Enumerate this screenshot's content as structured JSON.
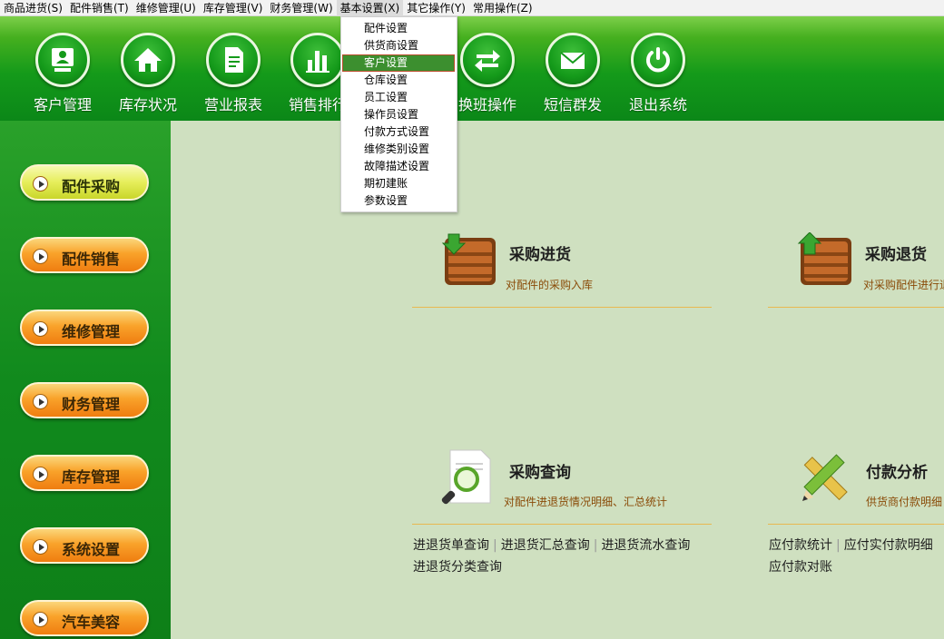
{
  "menubar": {
    "items": [
      {
        "label": "商品进货(S)"
      },
      {
        "label": "配件销售(T)"
      },
      {
        "label": "维修管理(U)"
      },
      {
        "label": "库存管理(V)"
      },
      {
        "label": "财务管理(W)"
      },
      {
        "label": "基本设置(X)"
      },
      {
        "label": "其它操作(Y)"
      },
      {
        "label": "常用操作(Z)"
      }
    ],
    "active_index": 5
  },
  "toolbar": {
    "buttons": [
      {
        "label": "客户管理",
        "icon": "customer-icon"
      },
      {
        "label": "库存状况",
        "icon": "home-icon"
      },
      {
        "label": "营业报表",
        "icon": "report-icon"
      },
      {
        "label": "销售排行",
        "icon": "bar-chart-icon"
      },
      {
        "label": "",
        "icon": ""
      },
      {
        "label": "换班操作",
        "icon": "swap-arrows-icon"
      },
      {
        "label": "短信群发",
        "icon": "envelope-icon"
      },
      {
        "label": "退出系统",
        "icon": "power-icon"
      }
    ]
  },
  "dropdown": {
    "items": [
      {
        "label": "配件设置"
      },
      {
        "label": "供货商设置"
      },
      {
        "label": "客户设置"
      },
      {
        "label": "仓库设置"
      },
      {
        "label": "员工设置"
      },
      {
        "label": "操作员设置"
      },
      {
        "label": "付款方式设置"
      },
      {
        "label": "维修类别设置"
      },
      {
        "label": "故障描述设置"
      },
      {
        "label": "期初建账"
      },
      {
        "label": "参数设置"
      }
    ],
    "highlighted_index": 2
  },
  "sidebar": {
    "buttons": [
      {
        "label": "配件采购"
      },
      {
        "label": "配件销售"
      },
      {
        "label": "维修管理"
      },
      {
        "label": "财务管理"
      },
      {
        "label": "库存管理"
      },
      {
        "label": "系统设置"
      },
      {
        "label": "汽车美容"
      }
    ]
  },
  "cards": [
    {
      "title": "采购进货",
      "desc": "对配件的采购入库",
      "icon": "crate-down-icon"
    },
    {
      "title": "采购退货",
      "desc": "对采购配件进行退",
      "icon": "crate-up-icon"
    },
    {
      "title": "采购查询",
      "desc": "对配件进退货情况明细、汇总统计",
      "icon": "magnifier-document-icon",
      "links": [
        "进退货单查询",
        "进退货汇总查询",
        "进退货流水查询",
        "进退货分类查询"
      ]
    },
    {
      "title": "付款分析",
      "desc": "供货商付款明细",
      "icon": "pencil-ruler-icon",
      "links": [
        "应付款统计",
        "应付实付款明细",
        "应付款对账"
      ]
    }
  ],
  "colors": {
    "toolbar_green": "#149a1a",
    "content_bg": "#cfe0c0",
    "menu_highlight": "#3c8f2f",
    "desc_text": "#8a4b08"
  }
}
